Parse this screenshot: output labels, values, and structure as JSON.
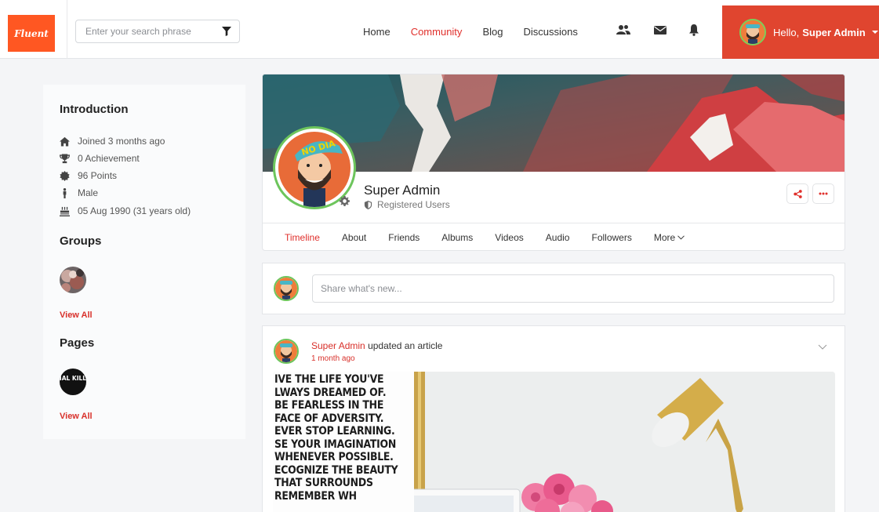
{
  "header": {
    "logo": "Fluent",
    "search_placeholder": "Enter your search phrase",
    "nav": [
      {
        "label": "Home",
        "active": false
      },
      {
        "label": "Community",
        "active": true
      },
      {
        "label": "Blog",
        "active": false
      },
      {
        "label": "Discussions",
        "active": false
      }
    ],
    "icons": [
      "users-icon",
      "mail-icon",
      "bell-icon"
    ],
    "greeting": "Hello,",
    "user_name": "Super Admin",
    "accent": "#e0452f"
  },
  "sidebar": {
    "intro_title": "Introduction",
    "info": [
      {
        "icon": "home-icon",
        "text": "Joined 3 months ago"
      },
      {
        "icon": "trophy-icon",
        "text": "0 Achievement"
      },
      {
        "icon": "badge-icon",
        "text": "96 Points"
      },
      {
        "icon": "male-icon",
        "text": "Male"
      },
      {
        "icon": "birthday-cake-icon",
        "text": "05 Aug 1990 (31 years old)"
      }
    ],
    "groups_title": "Groups",
    "groups_view_all": "View All",
    "pages_title": "Pages",
    "page_thumb_text": "SERIAL KILLERS",
    "pages_view_all": "View All"
  },
  "profile": {
    "name": "Super Admin",
    "role": "Registered Users",
    "avatar_cap_text": "NO DIA",
    "tabs": [
      {
        "label": "Timeline",
        "active": true
      },
      {
        "label": "About",
        "active": false
      },
      {
        "label": "Friends",
        "active": false
      },
      {
        "label": "Albums",
        "active": false
      },
      {
        "label": "Videos",
        "active": false
      },
      {
        "label": "Audio",
        "active": false
      },
      {
        "label": "Followers",
        "active": false
      },
      {
        "label": "More",
        "active": false
      }
    ]
  },
  "composer": {
    "placeholder": "Share what's new..."
  },
  "feed": {
    "author": "Super Admin",
    "action": "updated an article",
    "time": "1 month ago",
    "poster_lines": [
      "IVE THE LIFE YOU'VE",
      "LWAYS DREAMED OF.",
      "BE FEARLESS IN THE",
      "FACE OF ADVERSITY.",
      "EVER STOP LEARNING.",
      "SE YOUR IMAGINATION",
      "WHENEVER POSSIBLE.",
      "ECOGNIZE THE BEAUTY",
      "THAT SURROUNDS",
      "REMEMBER WH"
    ]
  }
}
